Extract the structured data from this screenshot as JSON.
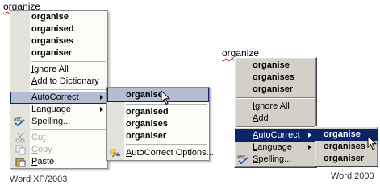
{
  "left": {
    "misspelled_word": "organize",
    "suggestions": [
      "organise",
      "organised",
      "organises",
      "organiser"
    ],
    "ignore_all": {
      "pre": "",
      "key": "I",
      "post": "gnore All"
    },
    "add_to_dictionary": {
      "pre": "",
      "key": "A",
      "post": "dd to Dictionary"
    },
    "autocorrect": {
      "pre": "",
      "key": "A",
      "post": "utoCorrect"
    },
    "language": {
      "pre": "",
      "key": "L",
      "post": "anguage"
    },
    "spelling": {
      "pre": "",
      "key": "S",
      "post": "pelling..."
    },
    "cut": {
      "pre": "Cu",
      "key": "t",
      "post": ""
    },
    "copy": {
      "pre": "",
      "key": "C",
      "post": "opy"
    },
    "paste": {
      "pre": "",
      "key": "P",
      "post": "aste"
    },
    "submenu": {
      "suggestions": [
        "organise",
        "organised",
        "organises",
        "organiser"
      ],
      "autocorrect_options": {
        "pre": "",
        "key": "A",
        "post": "utoCorrect Options..."
      }
    },
    "caption": "Word XP/2003"
  },
  "right": {
    "misspelled_word": "organize",
    "suggestions": [
      "organise",
      "organises",
      "organiser"
    ],
    "ignore_all": {
      "pre": "",
      "key": "I",
      "post": "gnore All"
    },
    "add": {
      "pre": "",
      "key": "A",
      "post": "dd"
    },
    "autocorrect": {
      "pre": "",
      "key": "A",
      "post": "utoCorrect"
    },
    "language": {
      "pre": "",
      "key": "L",
      "post": "anguage"
    },
    "spelling": {
      "pre": "",
      "key": "S",
      "post": "pelling..."
    },
    "submenu": {
      "suggestions": [
        "organise",
        "organises",
        "organiser"
      ]
    },
    "caption": "Word 2000"
  },
  "icons": {
    "spelling": "spelling-check-icon",
    "cut": "scissors-icon",
    "copy": "copy-icon",
    "paste": "clipboard-icon",
    "autocorrect_options": "autocorrect-lightning-icon",
    "cursor": "mouse-pointer-icon"
  },
  "colors": {
    "xp_highlight": "#b6bdd2",
    "xp_gutter": "#e3e3dc",
    "w2k_face": "#d4d0c8",
    "w2k_highlight": "#0a246a",
    "squiggle": "#d21919"
  }
}
